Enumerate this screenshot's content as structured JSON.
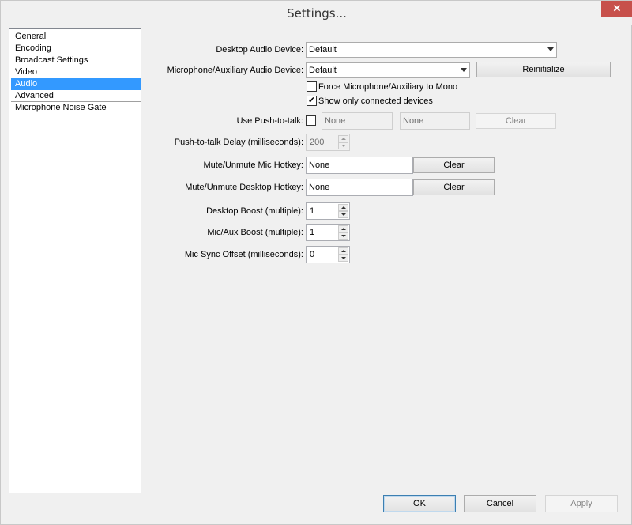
{
  "window": {
    "title": "Settings...",
    "close_glyph": "✕"
  },
  "sidebar": {
    "items": [
      {
        "label": "General",
        "selected": false
      },
      {
        "label": "Encoding",
        "selected": false
      },
      {
        "label": "Broadcast Settings",
        "selected": false
      },
      {
        "label": "Video",
        "selected": false
      },
      {
        "label": "Audio",
        "selected": true
      },
      {
        "label": "Advanced",
        "selected": false
      },
      {
        "label": "Microphone Noise Gate",
        "selected": false
      }
    ]
  },
  "audio": {
    "desktop_device": {
      "label": "Desktop Audio Device:",
      "value": "Default"
    },
    "mic_device": {
      "label": "Microphone/Auxiliary Audio Device:",
      "value": "Default"
    },
    "reinitialize_label": "Reinitialize",
    "force_mono": {
      "label": "Force Microphone/Auxiliary to Mono",
      "checked": false
    },
    "show_connected": {
      "label": "Show only connected devices",
      "checked": true
    },
    "push_to_talk": {
      "label": "Use Push-to-talk:",
      "checked": false,
      "hotkey1": "None",
      "hotkey2": "None",
      "clear_label": "Clear"
    },
    "ptt_delay": {
      "label": "Push-to-talk Delay (milliseconds):",
      "value": "200"
    },
    "mute_mic_hotkey": {
      "label": "Mute/Unmute Mic Hotkey:",
      "value": "None",
      "clear_label": "Clear"
    },
    "mute_desktop_hotkey": {
      "label": "Mute/Unmute Desktop Hotkey:",
      "value": "None",
      "clear_label": "Clear"
    },
    "desktop_boost": {
      "label": "Desktop Boost (multiple):",
      "value": "1"
    },
    "mic_boost": {
      "label": "Mic/Aux Boost (multiple):",
      "value": "1"
    },
    "mic_sync_offset": {
      "label": "Mic Sync Offset (milliseconds):",
      "value": "0"
    }
  },
  "footer": {
    "ok_label": "OK",
    "cancel_label": "Cancel",
    "apply_label": "Apply"
  },
  "colors": {
    "selection": "#3399ff",
    "close_button": "#c7504b"
  }
}
